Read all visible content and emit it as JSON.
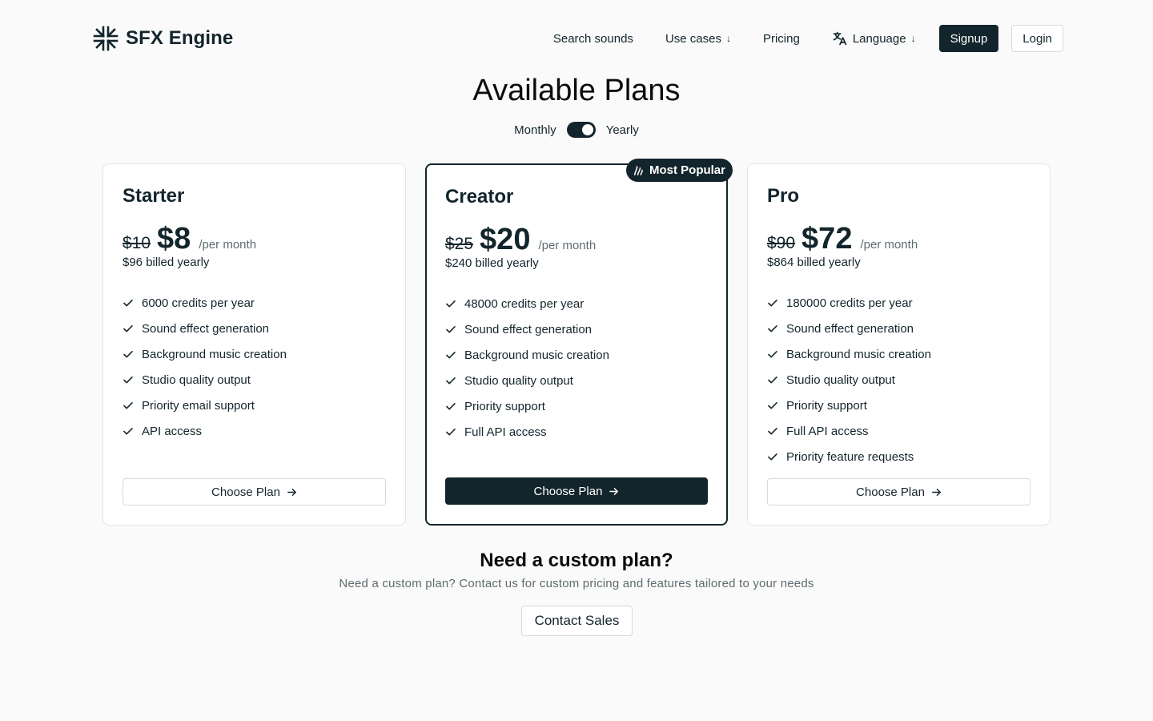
{
  "brand": {
    "name": "SFX Engine",
    "logo_icon": "compress-arrows-icon"
  },
  "nav": {
    "search": "Search sounds",
    "use_cases": "Use cases",
    "pricing": "Pricing",
    "language": "Language",
    "dropdown_arrow": "↓",
    "signup": "Signup",
    "login": "Login"
  },
  "page": {
    "title": "Available Plans"
  },
  "billing": {
    "monthly": "Monthly",
    "yearly": "Yearly",
    "selected": "Yearly"
  },
  "plans": [
    {
      "name": "Starter",
      "old_price": "$10",
      "price": "$8",
      "period": "/per month",
      "billed": "$96 billed yearly",
      "features": [
        "6000 credits per year",
        "Sound effect generation",
        "Background music creation",
        "Studio quality output",
        "Priority email support",
        "API access"
      ],
      "cta": "Choose Plan"
    },
    {
      "name": "Creator",
      "badge": "Most Popular",
      "old_price": "$25",
      "price": "$20",
      "period": "/per month",
      "billed": "$240 billed yearly",
      "features": [
        "48000 credits per year",
        "Sound effect generation",
        "Background music creation",
        "Studio quality output",
        "Priority support",
        "Full API access"
      ],
      "cta": "Choose Plan"
    },
    {
      "name": "Pro",
      "old_price": "$90",
      "price": "$72",
      "period": "/per month",
      "billed": "$864 billed yearly",
      "features": [
        "180000 credits per year",
        "Sound effect generation",
        "Background music creation",
        "Studio quality output",
        "Priority support",
        "Full API access",
        "Priority feature requests"
      ],
      "cta": "Choose Plan"
    }
  ],
  "custom": {
    "title": "Need a custom plan?",
    "description": "Need a custom plan? Contact us for custom pricing and features tailored to your needs",
    "cta": "Contact Sales"
  },
  "colors": {
    "primary": "#13252c",
    "background": "#fafafa",
    "muted": "#5f6b70",
    "border": "#e3e5e6"
  }
}
